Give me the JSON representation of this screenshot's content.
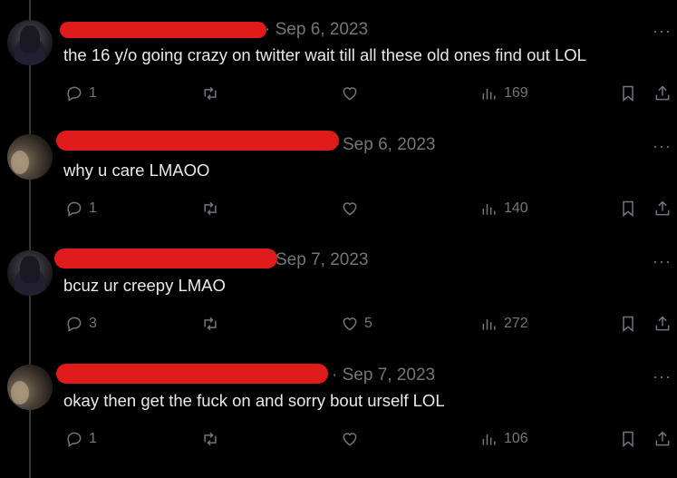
{
  "tweets": [
    {
      "date_label": "· Sep 6, 2023",
      "text": "the 16 y/o going crazy on twitter wait till all these old ones find out LOL",
      "replies": "1",
      "likes": "",
      "views": "169"
    },
    {
      "date_label": "Sep 6, 2023",
      "text": "why u care LMAOO",
      "replies": "1",
      "likes": "",
      "views": "140"
    },
    {
      "date_label": "Sep 7, 2023",
      "text": "bcuz ur creepy LMAO",
      "replies": "3",
      "likes": "5",
      "views": "272"
    },
    {
      "date_label": "· Sep 7, 2023",
      "text": "okay then get the fuck on and sorry bout urself LOL",
      "replies": "1",
      "likes": "",
      "views": "106"
    }
  ],
  "more_label": "···",
  "icons": {
    "reply": "reply-icon",
    "retweet": "retweet-icon",
    "like": "heart-icon",
    "views": "views-icon",
    "bookmark": "bookmark-icon",
    "share": "share-icon"
  },
  "colors": {
    "background": "#000000",
    "text": "#e7e9ea",
    "muted": "#71767b",
    "redaction": "#e01b1b"
  }
}
